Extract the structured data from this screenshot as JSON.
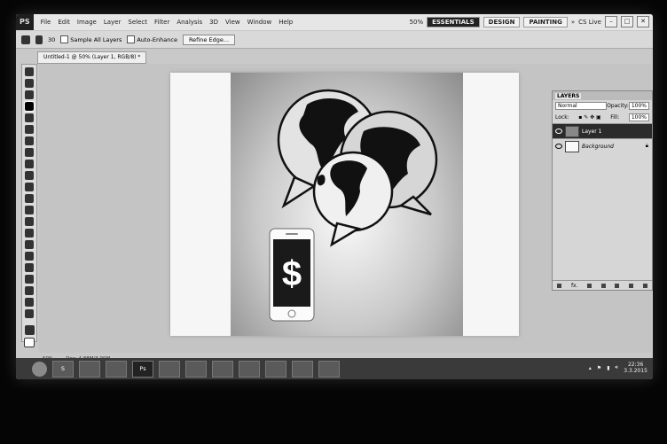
{
  "app": {
    "logo": "PS"
  },
  "menu": [
    "File",
    "Edit",
    "Image",
    "Layer",
    "Select",
    "Filter",
    "Analysis",
    "3D",
    "View",
    "Window",
    "Help"
  ],
  "menubar_right": {
    "zoom": "50%",
    "workspaces": [
      "ESSENTIALS",
      "DESIGN",
      "PAINTING"
    ],
    "more": "»",
    "cslive": "CS Live"
  },
  "options": {
    "brush_size": "30",
    "sample_all_layers": "Sample All Layers",
    "auto_enhance": "Auto-Enhance",
    "refine_edge": "Refine Edge..."
  },
  "document_tab": "Untitled-1 @ 50% (Layer 1, RGB/8) *",
  "canvas": {
    "symbol": "$"
  },
  "status": {
    "zoom": "50%",
    "doc": "Doc: 4.88M/3.99M"
  },
  "layers_panel": {
    "tabs": [
      "LAYERS"
    ],
    "blend_mode": "Normal",
    "opacity_label": "Opacity:",
    "opacity": "100%",
    "lock_label": "Lock:",
    "fill_label": "Fill:",
    "fill": "100%",
    "layers": [
      {
        "name": "Layer 1",
        "selected": true
      },
      {
        "name": "Background",
        "selected": false
      }
    ],
    "footer_fx": "fx."
  },
  "taskbar": {
    "apps": [
      "S",
      "",
      "",
      "Ps",
      "",
      "",
      "",
      "",
      "",
      "",
      ""
    ],
    "time": "22:36",
    "date": "3.3.2015"
  }
}
